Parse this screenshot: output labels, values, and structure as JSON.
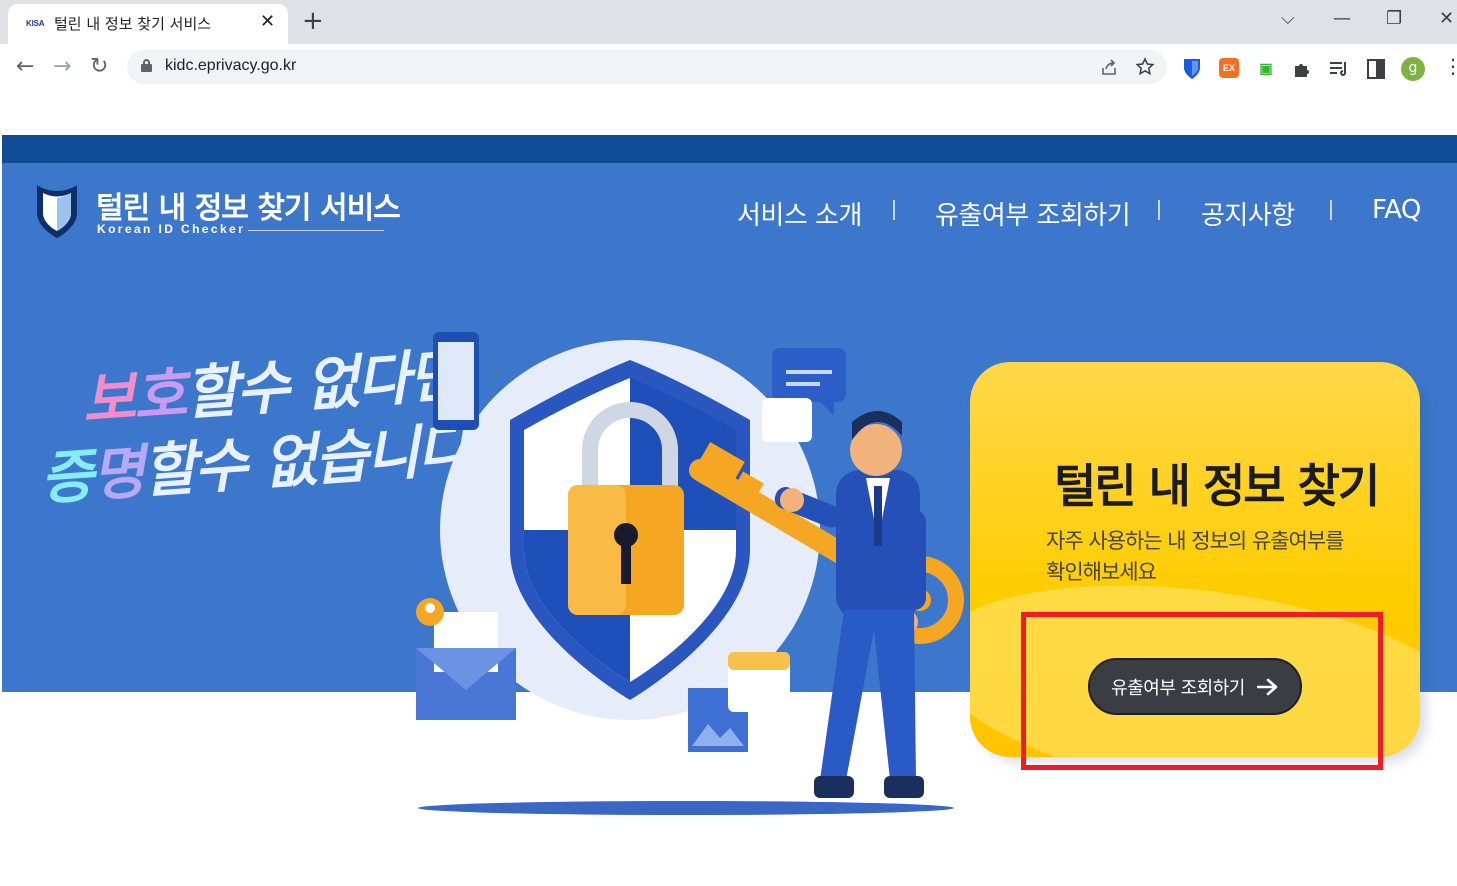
{
  "browser": {
    "tab": {
      "favicon_text": "KISA",
      "title": "털린 내 정보 찾기 서비스",
      "close_glyph": "✕"
    },
    "new_tab_glyph": "+",
    "window_controls": {
      "dropdown": "⌵",
      "minimize": "—",
      "restore": "❐",
      "close": "✕"
    },
    "nav": {
      "back": "←",
      "forward": "→",
      "reload": "↻"
    },
    "url": "kidc.eprivacy.go.kr",
    "omnibox_icons": [
      "share-icon",
      "bookmark-star-icon"
    ],
    "extensions": [
      {
        "name": "bitwarden-extension-icon",
        "label": "",
        "color": "#175ddc"
      },
      {
        "name": "ex-extension-icon",
        "label": "EX",
        "color": "#f36f21"
      },
      {
        "name": "green-extension-icon",
        "label": "▣",
        "color": "#2eb82e"
      },
      {
        "name": "puzzle-extension-icon",
        "label": "",
        "color": "#3c4043"
      },
      {
        "name": "media-control-icon",
        "label": "",
        "color": "#3c4043"
      },
      {
        "name": "side-panel-icon",
        "label": "",
        "color": "#3c4043"
      }
    ],
    "profile_initial": "g",
    "menu_glyph": "⋮"
  },
  "site": {
    "colors": {
      "top_band": "#0f4d94",
      "hero_bg": "#3d77cb",
      "card": "#ffcc00",
      "cta": "#3a3d43",
      "highlight": "#ee1c24"
    },
    "logo": {
      "title": "털린 내 정보 찾기 서비스",
      "subtitle": "Korean ID Checker"
    },
    "nav": {
      "items": [
        "서비스 소개",
        "유출여부 조회하기",
        "공지사항",
        "FAQ"
      ]
    },
    "slogan": {
      "line1": {
        "accent1": "보",
        "accent2": "호",
        "rest": "할수 없다면"
      },
      "line2": {
        "accent1": "증",
        "accent2": "명",
        "rest": "할수 없습니다—"
      }
    },
    "card": {
      "title": "털린 내 정보 찾기",
      "desc_line1": "자주 사용하는 내 정보의 유출여부를",
      "desc_line2": "확인해보세요",
      "cta_label": "유출여부 조회하기"
    }
  }
}
